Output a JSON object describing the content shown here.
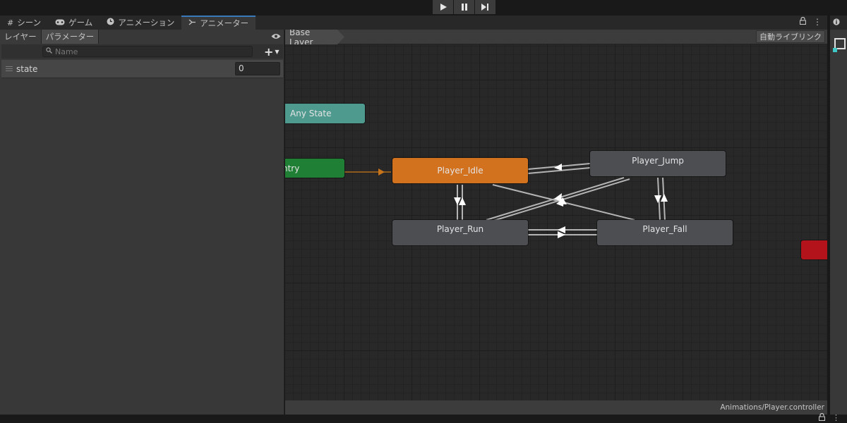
{
  "toolbar": {
    "play_icon": "play-icon",
    "pause_icon": "pause-icon",
    "step_icon": "step-icon"
  },
  "tabs": [
    {
      "label": "シーン",
      "icon": "grid-icon"
    },
    {
      "label": "ゲーム",
      "icon": "gamepad-icon"
    },
    {
      "label": "アニメーション",
      "icon": "clock-icon"
    },
    {
      "label": "アニメーター",
      "icon": "animator-icon",
      "active": true
    }
  ],
  "left_panel": {
    "subtabs": [
      "レイヤー",
      "パラメーター"
    ],
    "search": {
      "placeholder": "Name",
      "value": ""
    },
    "parameters": [
      {
        "name": "state",
        "value": "0"
      }
    ]
  },
  "graph": {
    "breadcrumb": "Base Layer",
    "auto_live_link": "自動ライブリンク",
    "controller_path": "Animations/Player.controller",
    "nodes": {
      "any_state": "Any State",
      "entry": "ntry",
      "idle": "Player_Idle",
      "jump": "Player_Jump",
      "run": "Player_Run",
      "fall": "Player_Fall",
      "exit": ""
    }
  },
  "colors": {
    "accent": "#3a79bb",
    "default_state": "#d2711e",
    "entry": "#1f7f35",
    "any_state": "#4e9a8e",
    "exit": "#b3141c",
    "state": "#4c4e52"
  }
}
